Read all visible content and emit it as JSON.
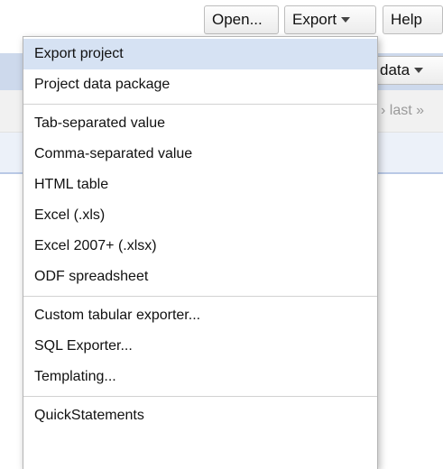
{
  "toolbar": {
    "open_label": "Open...",
    "export_label": "Export",
    "help_label": "Help"
  },
  "background": {
    "data_button_label": "data",
    "pager_text": "› last »"
  },
  "colors": {
    "highlight": "#d6e2f3",
    "header_band": "#cdd9ec"
  },
  "export_menu": {
    "highlighted_item": "Export project",
    "groups": [
      [
        "Export project",
        "Project data package"
      ],
      [
        "Tab-separated value",
        "Comma-separated value",
        "HTML table",
        "Excel (.xls)",
        "Excel 2007+ (.xlsx)",
        "ODF spreadsheet"
      ],
      [
        "Custom tabular exporter...",
        "SQL Exporter...",
        "Templating..."
      ],
      [
        "QuickStatements"
      ]
    ]
  }
}
